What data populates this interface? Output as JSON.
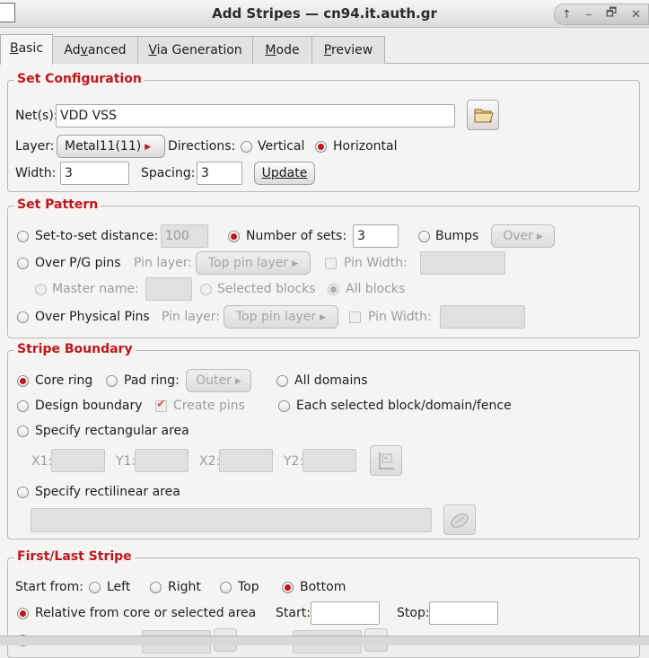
{
  "window": {
    "title": "Add Stripes — cn94.it.auth.gr",
    "controls": [
      "↑",
      "–",
      "🗗",
      "✕"
    ]
  },
  "tabs": [
    {
      "label": "Basic",
      "mnemonic": "B"
    },
    {
      "label": "Advanced",
      "mnemonic": "v"
    },
    {
      "label": "Via Generation",
      "mnemonic": "V"
    },
    {
      "label": "Mode",
      "mnemonic": "M"
    },
    {
      "label": "Preview",
      "mnemonic": "P"
    }
  ],
  "set_configuration": {
    "title": "Set Configuration",
    "nets_label": "Net(s):",
    "nets_value": "VDD VSS",
    "layer_label": "Layer:",
    "layer_value": "Metal11(11)",
    "directions_label": "Directions:",
    "vertical_label": "Vertical",
    "horizontal_label": "Horizontal",
    "direction_selected": "Horizontal",
    "width_label": "Width:",
    "width_value": "3",
    "spacing_label": "Spacing:",
    "spacing_value": "3",
    "update_label": "Update"
  },
  "set_pattern": {
    "title": "Set Pattern",
    "set_to_set_label": "Set-to-set distance:",
    "set_to_set_value": "100",
    "number_of_sets_label": "Number of sets:",
    "number_of_sets_value": "3",
    "bumps_label": "Bumps",
    "over_label": "Over",
    "over_pg_pins_label": "Over P/G pins",
    "pin_layer_label": "Pin layer:",
    "top_pin_layer_label": "Top pin layer",
    "pin_width_label": "Pin Width:",
    "master_name_label": "Master name:",
    "selected_blocks_label": "Selected blocks",
    "all_blocks_label": "All blocks",
    "over_physical_pins_label": "Over Physical Pins",
    "pin_layer_label_2": "Pin layer:",
    "top_pin_layer_label_2": "Top pin layer",
    "pin_width_label_2": "Pin Width:"
  },
  "stripe_boundary": {
    "title": "Stripe Boundary",
    "core_ring_label": "Core ring",
    "pad_ring_label": "Pad ring:",
    "outer_label": "Outer",
    "all_domains_label": "All domains",
    "design_boundary_label": "Design boundary",
    "create_pins_label": "Create pins",
    "each_selected_label": "Each selected block/domain/fence",
    "specify_rect_label": "Specify rectangular area",
    "x1_label": "X1:",
    "y1_label": "Y1:",
    "x2_label": "X2:",
    "y2_label": "Y2:",
    "specify_rectilinear_label": "Specify rectilinear area"
  },
  "first_last_stripe": {
    "title": "First/Last Stripe",
    "start_from_label": "Start from:",
    "left_label": "Left",
    "right_label": "Right",
    "top_label": "Top",
    "bottom_label": "Bottom",
    "relative_label": "Relative from core or selected area",
    "start_label": "Start:",
    "stop_label": "Stop:"
  },
  "colors": {
    "accent": "#c0161c",
    "background": "#f5f4f2"
  }
}
